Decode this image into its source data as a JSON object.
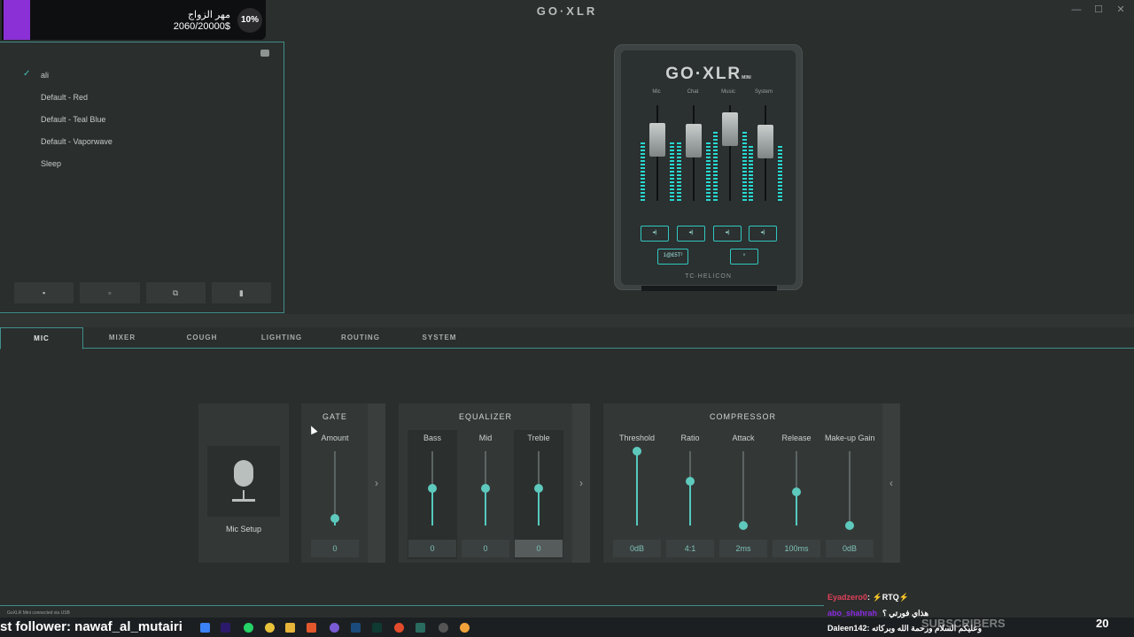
{
  "app": {
    "title": "GO·XLR"
  },
  "window_controls": {
    "minimize": "—",
    "maximize": "☐",
    "close": "✕"
  },
  "donation": {
    "title": "مهر الزواج",
    "amount": "2060/20000$",
    "percent": "10%"
  },
  "profiles": {
    "items": [
      {
        "label": "ali",
        "selected": true
      },
      {
        "label": "Default - Red",
        "selected": false
      },
      {
        "label": "Default - Teal Blue",
        "selected": false
      },
      {
        "label": "Default - Vaporwave",
        "selected": false
      },
      {
        "label": "Sleep",
        "selected": false
      }
    ],
    "check": "✓",
    "buttons": [
      {
        "name": "save",
        "icon": "save-icon",
        "glyph": "▪"
      },
      {
        "name": "new",
        "icon": "new-file-icon",
        "glyph": "▫"
      },
      {
        "name": "duplicate",
        "icon": "copy-icon",
        "glyph": "⧉"
      },
      {
        "name": "delete",
        "icon": "trash-icon",
        "glyph": "▮"
      }
    ]
  },
  "device": {
    "logo": "GO·XLR",
    "logo_sub": "MINI",
    "channels": [
      "Mic",
      "Chat",
      "Music",
      "System"
    ],
    "fader_levels": [
      0.72,
      0.7,
      0.88,
      0.68
    ],
    "meter_levels": [
      0.62,
      0.62,
      0.72,
      0.58
    ],
    "mute_glyph": "◂)",
    "fx_button": "1@£5T²",
    "mic_mute_glyph": "♆",
    "brand": "TC·HELICON",
    "accent": "#27d9d1"
  },
  "tabs": [
    "MIC",
    "MIXER",
    "COUGH",
    "LIGHTING",
    "ROUTING",
    "SYSTEM"
  ],
  "active_tab": "MIC",
  "mic_setup": {
    "label": "Mic Setup"
  },
  "gate": {
    "title": "GATE",
    "controls": [
      {
        "label": "Amount",
        "value": "0",
        "level": 0.1
      }
    ]
  },
  "equalizer": {
    "title": "EQUALIZER",
    "controls": [
      {
        "label": "Bass",
        "value": "0",
        "level": 0.5
      },
      {
        "label": "Mid",
        "value": "0",
        "level": 0.5
      },
      {
        "label": "Treble",
        "value": "0",
        "level": 0.5
      }
    ]
  },
  "compressor": {
    "title": "COMPRESSOR",
    "controls": [
      {
        "label": "Threshold",
        "value": "0dB",
        "level": 1.0
      },
      {
        "label": "Ratio",
        "value": "4:1",
        "level": 0.6
      },
      {
        "label": "Attack",
        "value": "2ms",
        "level": 0.0
      },
      {
        "label": "Release",
        "value": "100ms",
        "level": 0.45
      },
      {
        "label": "Make-up Gain",
        "value": "0dB",
        "level": 0.0
      }
    ]
  },
  "arrows": {
    "gate": "›",
    "eq": "›",
    "comp": "‹"
  },
  "status": {
    "text": "GoXLR Mini connected via USB"
  },
  "overlay": {
    "follower": "st follower: nawaf_al_mutairi",
    "chat": [
      {
        "user": "Eyadzero0",
        "text": ": ⚡RTQ⚡"
      },
      {
        "user": "abo_shahrah",
        "text": "هذاي فورتي ؟"
      },
      {
        "user": "Daleen142",
        "text": ": وعليكم السلام ورحمة الله وبركاته"
      }
    ],
    "banner": "SUBSCRIBERS",
    "clock": "20"
  }
}
